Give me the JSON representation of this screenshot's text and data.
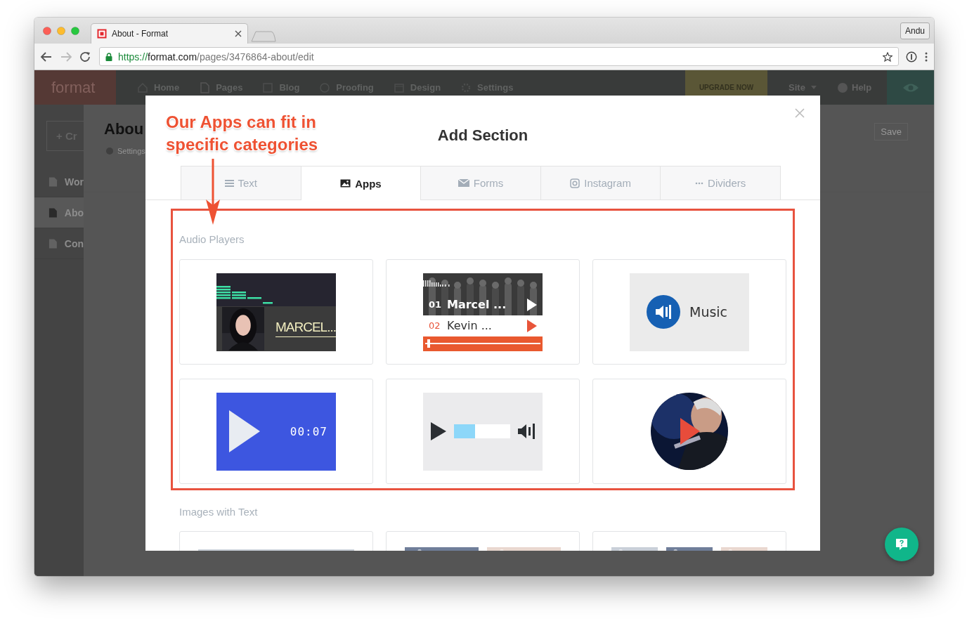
{
  "browser": {
    "tab_title": "About - Format",
    "profile": "Andu",
    "url_scheme": "https://",
    "url_host": "format.com",
    "url_path": "/pages/3476864-about/edit"
  },
  "app_header": {
    "logo": "format",
    "nav": [
      {
        "label": "Home"
      },
      {
        "label": "Pages"
      },
      {
        "label": "Blog"
      },
      {
        "label": "Proofing"
      },
      {
        "label": "Design"
      },
      {
        "label": "Settings"
      }
    ],
    "upgrade": "UPGRADE NOW",
    "site_menu": "Site",
    "help": "Help"
  },
  "sidebar": {
    "create_button": "+ Cr",
    "items": [
      {
        "label": "Wor",
        "selected": false
      },
      {
        "label": "Abo",
        "selected": true
      },
      {
        "label": "Con",
        "selected": false
      }
    ]
  },
  "page": {
    "title": "Abou",
    "settings": "Settings",
    "save": "Save"
  },
  "modal": {
    "title": "Add Section",
    "tabs": [
      {
        "label": "Text",
        "selected": false
      },
      {
        "label": "Apps",
        "selected": true
      },
      {
        "label": "Forms",
        "selected": false
      },
      {
        "label": "Instagram",
        "selected": false
      },
      {
        "label": "Dividers",
        "selected": false
      }
    ],
    "sections": [
      {
        "heading": "Audio Players",
        "highlighted": true,
        "cards": [
          {
            "kind": "portrait",
            "title": "MARCEL..."
          },
          {
            "kind": "playlist",
            "tracks": [
              {
                "number": "01",
                "title": "Marcel ...",
                "selected": true
              },
              {
                "number": "02",
                "title": "Kevin ...",
                "selected": false
              }
            ],
            "level": 0.03
          },
          {
            "kind": "music",
            "label": "Music"
          },
          {
            "kind": "blue",
            "time": "00:07"
          },
          {
            "kind": "bar",
            "level": 0.375
          },
          {
            "kind": "round"
          }
        ]
      },
      {
        "heading": "Images with Text",
        "highlighted": false,
        "cards": [
          {
            "kind": "gallery"
          },
          {
            "kind": "gallery"
          },
          {
            "kind": "gallery"
          }
        ]
      }
    ]
  },
  "annotation": {
    "text": "Our Apps can fit in specific categories"
  }
}
